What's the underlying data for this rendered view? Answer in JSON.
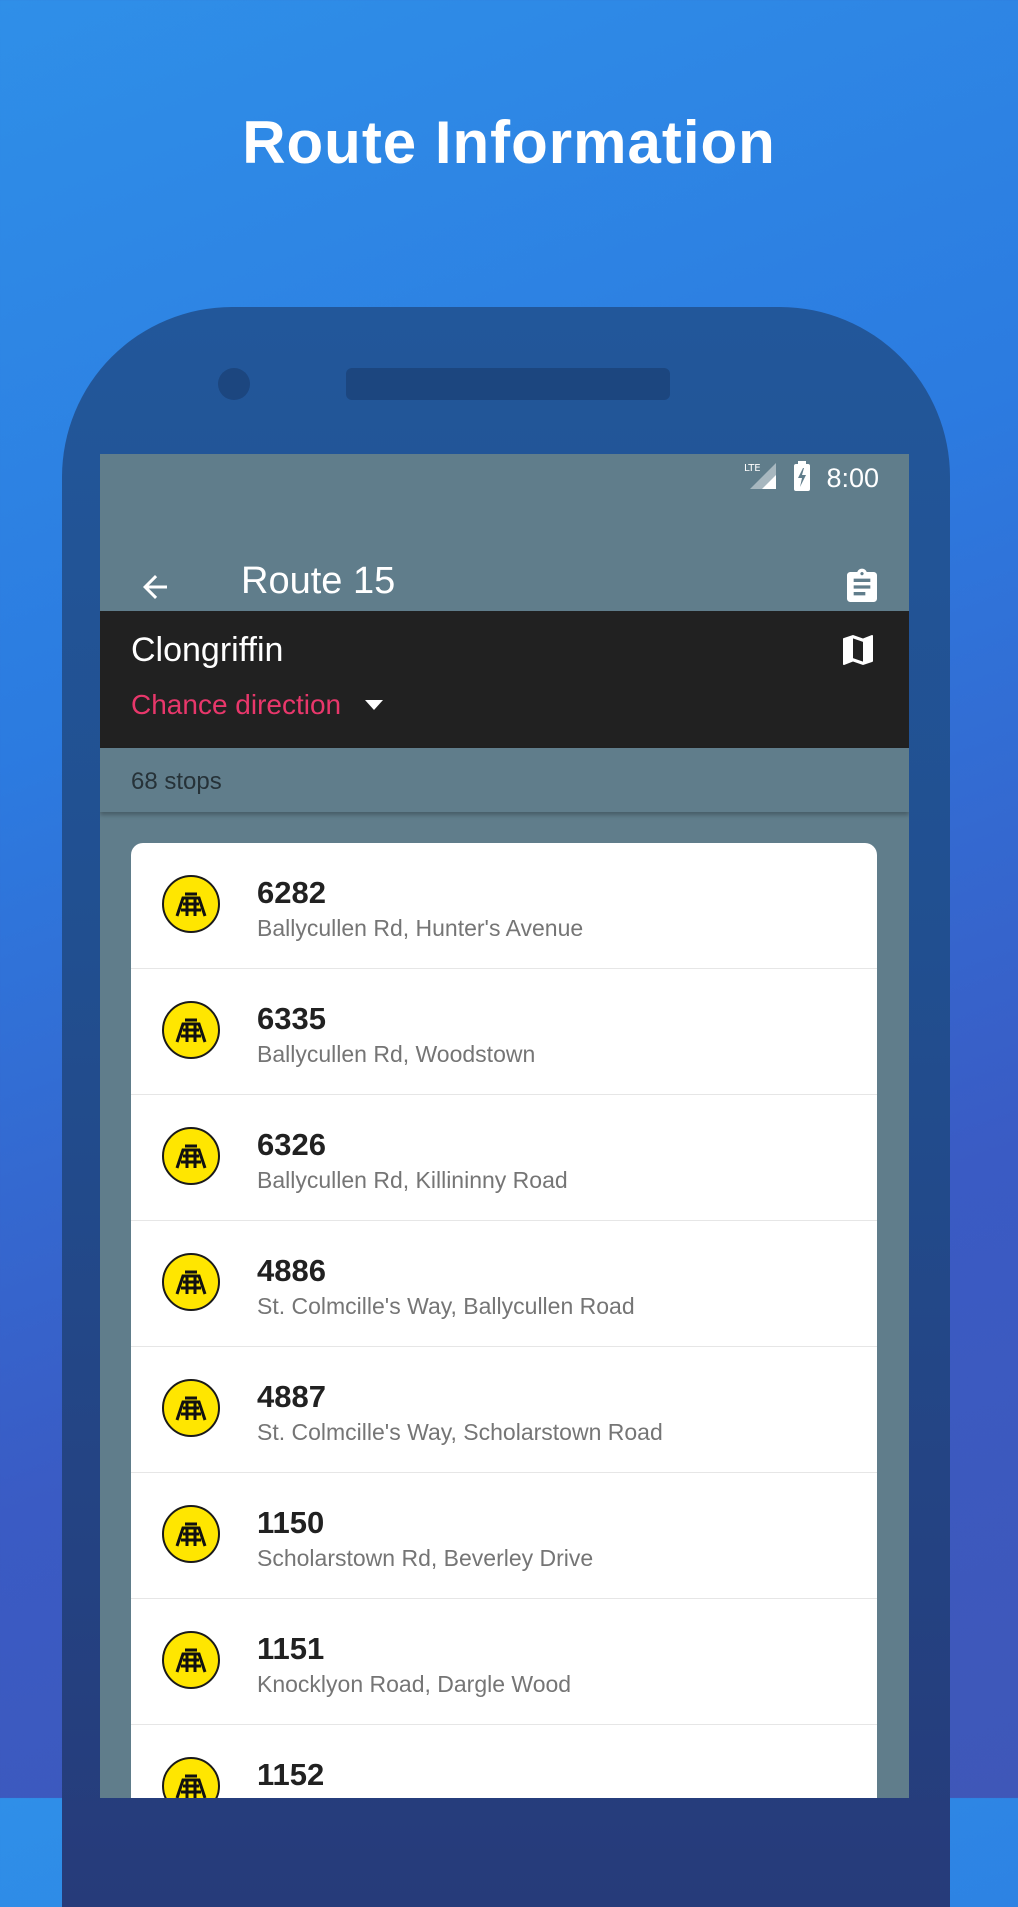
{
  "promo": {
    "title": "Route Information"
  },
  "status_bar": {
    "network": "LTE",
    "time": "8:00"
  },
  "app_bar": {
    "title": "Route 15"
  },
  "direction": {
    "destination": "Clongriffin",
    "change_label": "Chance direction"
  },
  "stops_count": "68 stops",
  "stops": [
    {
      "number": "6282",
      "name": "Ballycullen Rd, Hunter's Avenue"
    },
    {
      "number": "6335",
      "name": "Ballycullen Rd, Woodstown"
    },
    {
      "number": "6326",
      "name": "Ballycullen Rd, Killininny Road"
    },
    {
      "number": "4886",
      "name": "St. Colmcille's Way, Ballycullen Road"
    },
    {
      "number": "4887",
      "name": "St. Colmcille's Way, Scholarstown Road"
    },
    {
      "number": "1150",
      "name": "Scholarstown Rd, Beverley Drive"
    },
    {
      "number": "1151",
      "name": "Knocklyon Road, Dargle Wood"
    },
    {
      "number": "1152",
      "name": ""
    }
  ],
  "colors": {
    "background_top": "#2f8fe8",
    "phone_body": "#22579a",
    "toolbar": "#607d8b",
    "direction_panel": "#212121",
    "accent_pink": "#e8376b",
    "badge_yellow": "#ffe600"
  },
  "icons": {
    "back": "arrow-left-icon",
    "clipboard": "clipboard-icon",
    "map": "map-icon",
    "stop_badge": "dublin-bus-icon",
    "signal": "signal-icon",
    "battery": "battery-charging-icon"
  }
}
